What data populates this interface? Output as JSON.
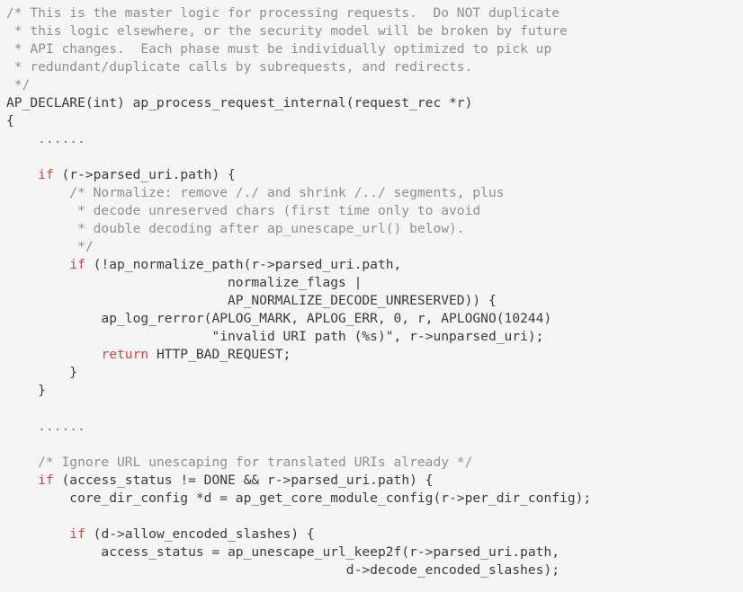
{
  "view": {
    "kind": "source-code-listing",
    "language": "C",
    "background_color": "#f5f5f5",
    "plain_color": "#3b3b3b",
    "comment_color": "#8f8f8f",
    "keyword_color": "#d14545"
  },
  "code": {
    "lines": [
      [
        {
          "t": "comment",
          "s": "/* This is the master logic for processing requests.  Do NOT duplicate"
        }
      ],
      [
        {
          "t": "comment",
          "s": " * this logic elsewhere, or the security model will be broken by future"
        }
      ],
      [
        {
          "t": "comment",
          "s": " * API changes.  Each phase must be individually optimized to pick up"
        }
      ],
      [
        {
          "t": "comment",
          "s": " * redundant/duplicate calls by subrequests, and redirects."
        }
      ],
      [
        {
          "t": "comment",
          "s": " */"
        }
      ],
      [
        {
          "t": "plain",
          "s": "AP_DECLARE(int) ap_process_request_internal(request_rec *r)"
        }
      ],
      [
        {
          "t": "plain",
          "s": "{"
        }
      ],
      [
        {
          "t": "dots",
          "s": "    ......"
        }
      ],
      [
        {
          "t": "blank",
          "s": " "
        }
      ],
      [
        {
          "t": "plain",
          "s": "    "
        },
        {
          "t": "keyword",
          "s": "if"
        },
        {
          "t": "plain",
          "s": " (r->parsed_uri.path) {"
        }
      ],
      [
        {
          "t": "comment",
          "s": "        /* Normalize: remove /./ and shrink /../ segments, plus"
        }
      ],
      [
        {
          "t": "comment",
          "s": "         * decode unreserved chars (first time only to avoid"
        }
      ],
      [
        {
          "t": "comment",
          "s": "         * double decoding after ap_unescape_url() below)."
        }
      ],
      [
        {
          "t": "comment",
          "s": "         */"
        }
      ],
      [
        {
          "t": "plain",
          "s": "        "
        },
        {
          "t": "keyword",
          "s": "if"
        },
        {
          "t": "plain",
          "s": " (!ap_normalize_path(r->parsed_uri.path,"
        }
      ],
      [
        {
          "t": "plain",
          "s": "                            normalize_flags |"
        }
      ],
      [
        {
          "t": "plain",
          "s": "                            AP_NORMALIZE_DECODE_UNRESERVED)) {"
        }
      ],
      [
        {
          "t": "plain",
          "s": "            ap_log_rerror(APLOG_MARK, APLOG_ERR, 0, r, APLOGNO(10244)"
        }
      ],
      [
        {
          "t": "plain",
          "s": "                          \"invalid URI path (%s)\", r->unparsed_uri);"
        }
      ],
      [
        {
          "t": "plain",
          "s": "            "
        },
        {
          "t": "keyword",
          "s": "return"
        },
        {
          "t": "plain",
          "s": " HTTP_BAD_REQUEST;"
        }
      ],
      [
        {
          "t": "plain",
          "s": "        }"
        }
      ],
      [
        {
          "t": "plain",
          "s": "    }"
        }
      ],
      [
        {
          "t": "blank",
          "s": " "
        }
      ],
      [
        {
          "t": "dots",
          "s": "    ......"
        }
      ],
      [
        {
          "t": "blank",
          "s": " "
        }
      ],
      [
        {
          "t": "comment",
          "s": "    /* Ignore URL unescaping for translated URIs already */"
        }
      ],
      [
        {
          "t": "plain",
          "s": "    "
        },
        {
          "t": "keyword",
          "s": "if"
        },
        {
          "t": "plain",
          "s": " (access_status != DONE && r->parsed_uri.path) {"
        }
      ],
      [
        {
          "t": "plain",
          "s": "        core_dir_config *d = ap_get_core_module_config(r->per_dir_config);"
        }
      ],
      [
        {
          "t": "blank",
          "s": " "
        }
      ],
      [
        {
          "t": "plain",
          "s": "        "
        },
        {
          "t": "keyword",
          "s": "if"
        },
        {
          "t": "plain",
          "s": " (d->allow_encoded_slashes) {"
        }
      ],
      [
        {
          "t": "plain",
          "s": "            access_status = ap_unescape_url_keep2f(r->parsed_uri.path,"
        }
      ],
      [
        {
          "t": "plain",
          "s": "                                           d->decode_encoded_slashes);"
        }
      ]
    ]
  }
}
